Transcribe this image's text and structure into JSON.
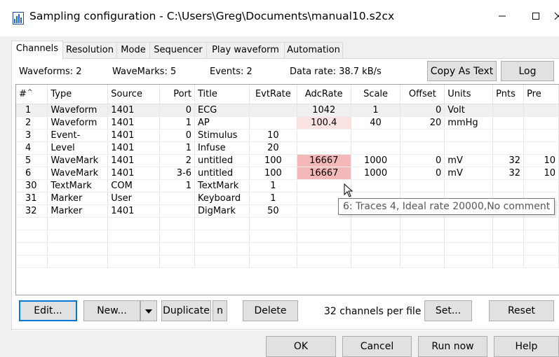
{
  "window": {
    "title": "Sampling configuration - C:\\Users\\Greg\\Documents\\manual10.s2cx",
    "min_icon": "minimize-icon",
    "max_icon": "maximize-icon",
    "close_icon": "close-icon"
  },
  "tabs": [
    {
      "label": "Channels"
    },
    {
      "label": "Resolution"
    },
    {
      "label": "Mode"
    },
    {
      "label": "Sequencer"
    },
    {
      "label": "Play waveform"
    },
    {
      "label": "Automation"
    }
  ],
  "stats": {
    "waveforms": "Waveforms: 2",
    "wavemarks": "WaveMarks: 5",
    "events": "Events: 2",
    "data_rate": "Data rate: 38.7 kB/s"
  },
  "buttons": {
    "copy_as_text": "Copy As Text",
    "log": "Log",
    "edit": "Edit...",
    "new": "New...",
    "duplicate": "Duplicate",
    "n": "n",
    "delete": "Delete",
    "set": "Set...",
    "reset": "Reset",
    "ok": "OK",
    "cancel": "Cancel",
    "run_now": "Run now",
    "help": "Help"
  },
  "channels_per_file": "32 channels per file",
  "table": {
    "columns": [
      "#",
      "Type",
      "Source",
      "Port",
      "Title",
      "EvtRate",
      "AdcRate",
      "Scale",
      "Offset",
      "Units",
      "Pnts",
      "Pre"
    ],
    "rows": [
      [
        "1",
        "Waveform",
        "1401",
        "0",
        "ECG",
        "",
        "1042",
        "1",
        "0",
        "Volt",
        "",
        ""
      ],
      [
        "2",
        "Waveform",
        "1401",
        "1",
        "AP",
        "",
        "100.4",
        "40",
        "20",
        "mmHg",
        "",
        ""
      ],
      [
        "3",
        "Event-",
        "1401",
        "0",
        "Stimulus",
        "10",
        "",
        "",
        "",
        "",
        "",
        ""
      ],
      [
        "4",
        "Level",
        "1401",
        "1",
        "Infuse",
        "20",
        "",
        "",
        "",
        "",
        "",
        ""
      ],
      [
        "5",
        "WaveMark",
        "1401",
        "2",
        "untitled",
        "100",
        "16667",
        "1000",
        "0",
        "mV",
        "32",
        "10"
      ],
      [
        "6",
        "WaveMark",
        "1401",
        "3-6",
        "untitled",
        "100",
        "16667",
        "1000",
        "0",
        "mV",
        "32",
        "10"
      ],
      [
        "30",
        "TextMark",
        "COM",
        "1",
        "TextMark",
        "1",
        "",
        "",
        "",
        "",
        "",
        ""
      ],
      [
        "31",
        "Marker",
        "User",
        "",
        "Keyboard",
        "1",
        "",
        "",
        "",
        "",
        "",
        ""
      ],
      [
        "32",
        "Marker",
        "1401",
        "",
        "DigMark",
        "50",
        "",
        "",
        "",
        "",
        "",
        ""
      ],
      [
        "",
        "",
        "",
        "",
        "",
        "",
        "",
        "",
        "",
        "",
        "",
        ""
      ],
      [
        "",
        "",
        "",
        "",
        "",
        "",
        "",
        "",
        "",
        "",
        "",
        ""
      ],
      [
        "",
        "",
        "",
        "",
        "",
        "",
        "",
        "",
        "",
        "",
        "",
        ""
      ],
      [
        "",
        "",
        "",
        "",
        "",
        "",
        "",
        "",
        "",
        "",
        "",
        ""
      ]
    ]
  },
  "tooltip": "6: Traces 4, Ideal rate 20000,No comment",
  "colors": {
    "adcrate_light": "#fbe3e3",
    "adcrate_strong": "#f4b8b8",
    "default_button_border": "#0078d7"
  }
}
